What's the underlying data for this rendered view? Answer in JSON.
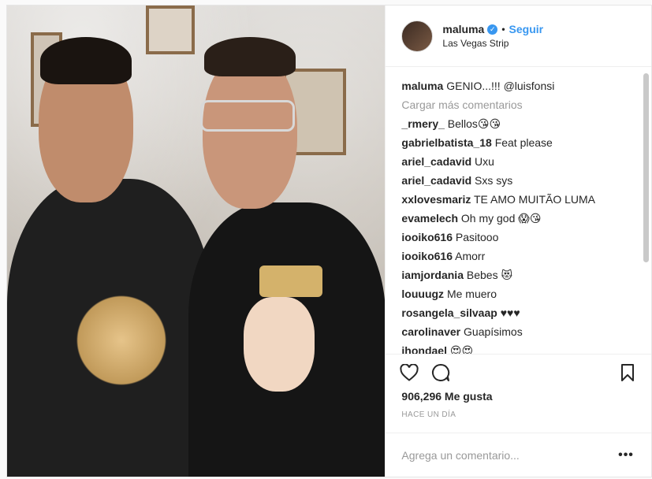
{
  "post": {
    "username": "maluma",
    "verified_icon": "verified-badge-icon",
    "follow_label": "Seguir",
    "separator": "•",
    "location": "Las Vegas Strip",
    "caption": {
      "user": "maluma",
      "text": "GENIO...!!! @luisfonsi"
    },
    "load_more_label": "Cargar más comentarios",
    "comments": [
      {
        "user": "_rmery_",
        "text": "Bellos😘😘"
      },
      {
        "user": "gabrielbatista_18",
        "text": "Feat please"
      },
      {
        "user": "ariel_cadavid",
        "text": "Uxu"
      },
      {
        "user": "ariel_cadavid",
        "text": "Sxs sys"
      },
      {
        "user": "xxlovesmariz",
        "text": "TE AMO MUITÃO LUMA"
      },
      {
        "user": "evamelech",
        "text": "Oh my god 😱😘"
      },
      {
        "user": "iooiko616",
        "text": "Pasitooo"
      },
      {
        "user": "iooiko616",
        "text": "Amorr"
      },
      {
        "user": "iamjordania",
        "text": "Bebes 😻"
      },
      {
        "user": "louuugz",
        "text": "Me muero"
      },
      {
        "user": "rosangela_silvaap",
        "text": "♥♥♥"
      },
      {
        "user": "carolinaver",
        "text": "Guapísimos"
      },
      {
        "user": "jhondael",
        "text": "😍😍"
      }
    ],
    "likes_label": "906,296 Me gusta",
    "time_label": "HACE UN DÍA",
    "add_comment_placeholder": "Agrega un comentario...",
    "more_label": "•••",
    "icons": {
      "like": "heart-icon",
      "comment": "comment-bubble-icon",
      "save": "bookmark-icon",
      "more": "more-options-icon"
    },
    "colors": {
      "accent": "#3897f0",
      "text": "#262626",
      "muted": "#999999",
      "border": "#efefef"
    }
  }
}
